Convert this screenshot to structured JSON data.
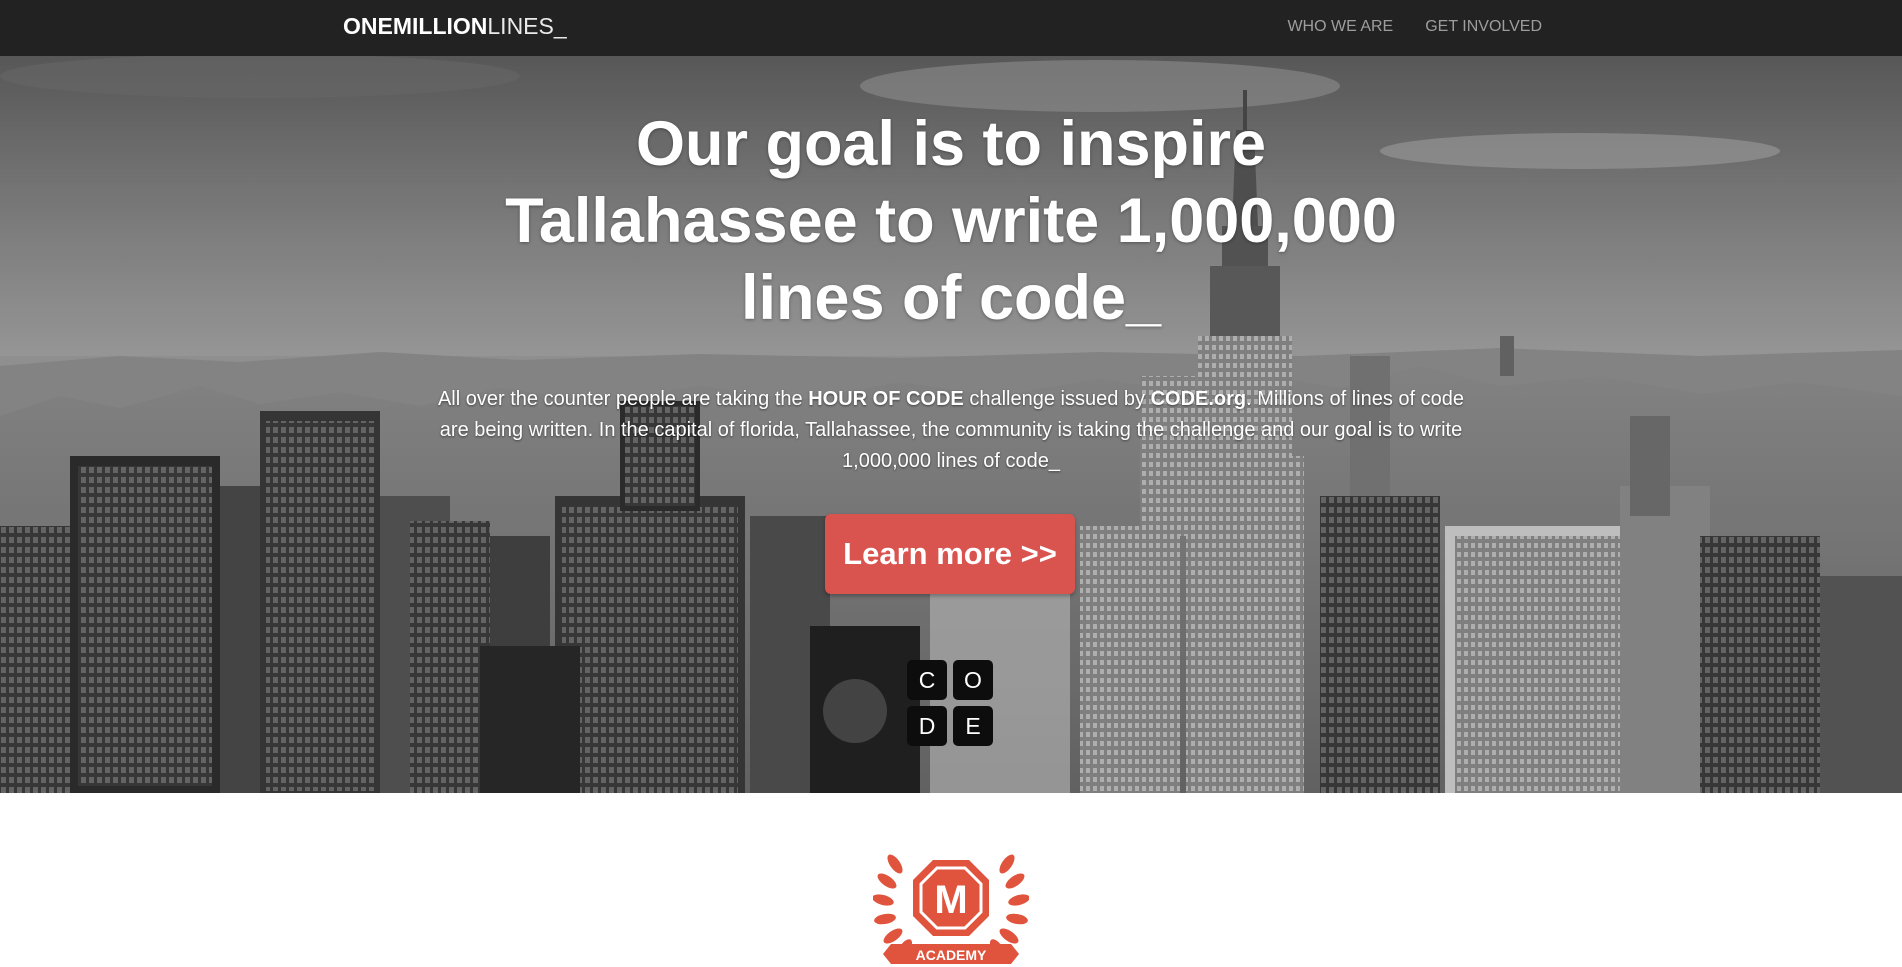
{
  "nav": {
    "brand_bold": "ONEMILLION",
    "brand_light": "LINES_",
    "links": [
      "WHO WE ARE",
      "GET INVOLVED"
    ]
  },
  "hero": {
    "title": "Our goal is to inspire Tallahassee to write 1,000,000 lines of code_",
    "text": {
      "part1": "All over the counter people are taking the ",
      "bold1": "HOUR OF CODE",
      "part2": " challenge issued by ",
      "bold2": "CODE.org",
      "part3": ". Millions of lines of code are being written. In the capital of florida, Tallahassee, the community is taking the challenge and our goal is to write 1,000,000 lines of code_"
    },
    "cta_label": "Learn more >>",
    "code_tiles": [
      "C",
      "O",
      "D",
      "E"
    ]
  },
  "academy": {
    "letter": "M",
    "label": "ACADEMY"
  },
  "colors": {
    "navbar": "#222222",
    "nav_link": "#9d9d9d",
    "cta": "#d9534f",
    "academy": "#e0533d"
  }
}
